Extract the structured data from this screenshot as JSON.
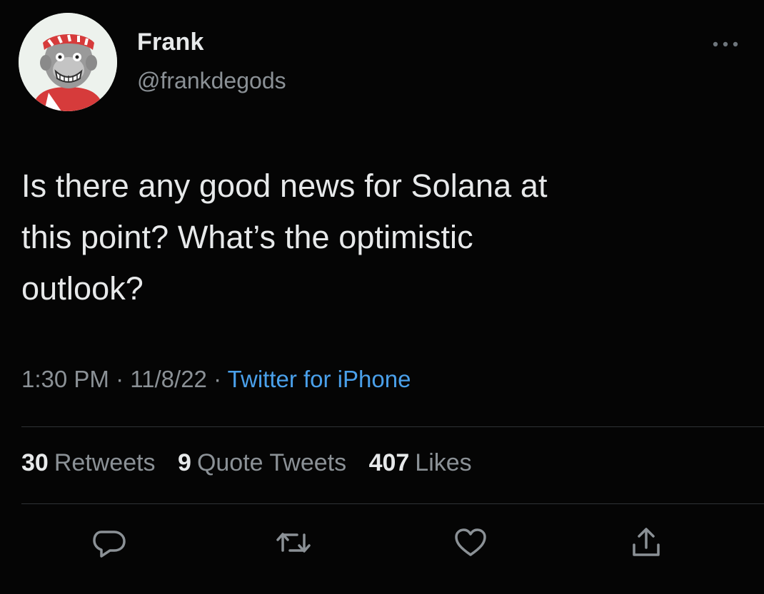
{
  "author": {
    "display_name": "Frank",
    "handle": "@frankdegods",
    "avatar_icon": "cartoon-ape-avatar-icon"
  },
  "tweet": {
    "text": "Is there any good news for Solana at\nthis point? What’s the optimistic\noutlook?",
    "time": "1:30 PM",
    "date": "11/8/22",
    "separator": "·",
    "source": "Twitter for iPhone"
  },
  "stats": {
    "retweets_count": "30",
    "retweets_label": "Retweets",
    "quotes_count": "9",
    "quotes_label": "Quote Tweets",
    "likes_count": "407",
    "likes_label": "Likes"
  },
  "actions": {
    "reply_icon": "reply-icon",
    "retweet_icon": "retweet-icon",
    "like_icon": "heart-icon",
    "share_icon": "share-icon"
  },
  "colors": {
    "background": "#050505",
    "primary_text": "#e7e9ea",
    "secondary_text": "#8b9196",
    "link": "#4aa0ea",
    "divider": "#2f3336"
  }
}
